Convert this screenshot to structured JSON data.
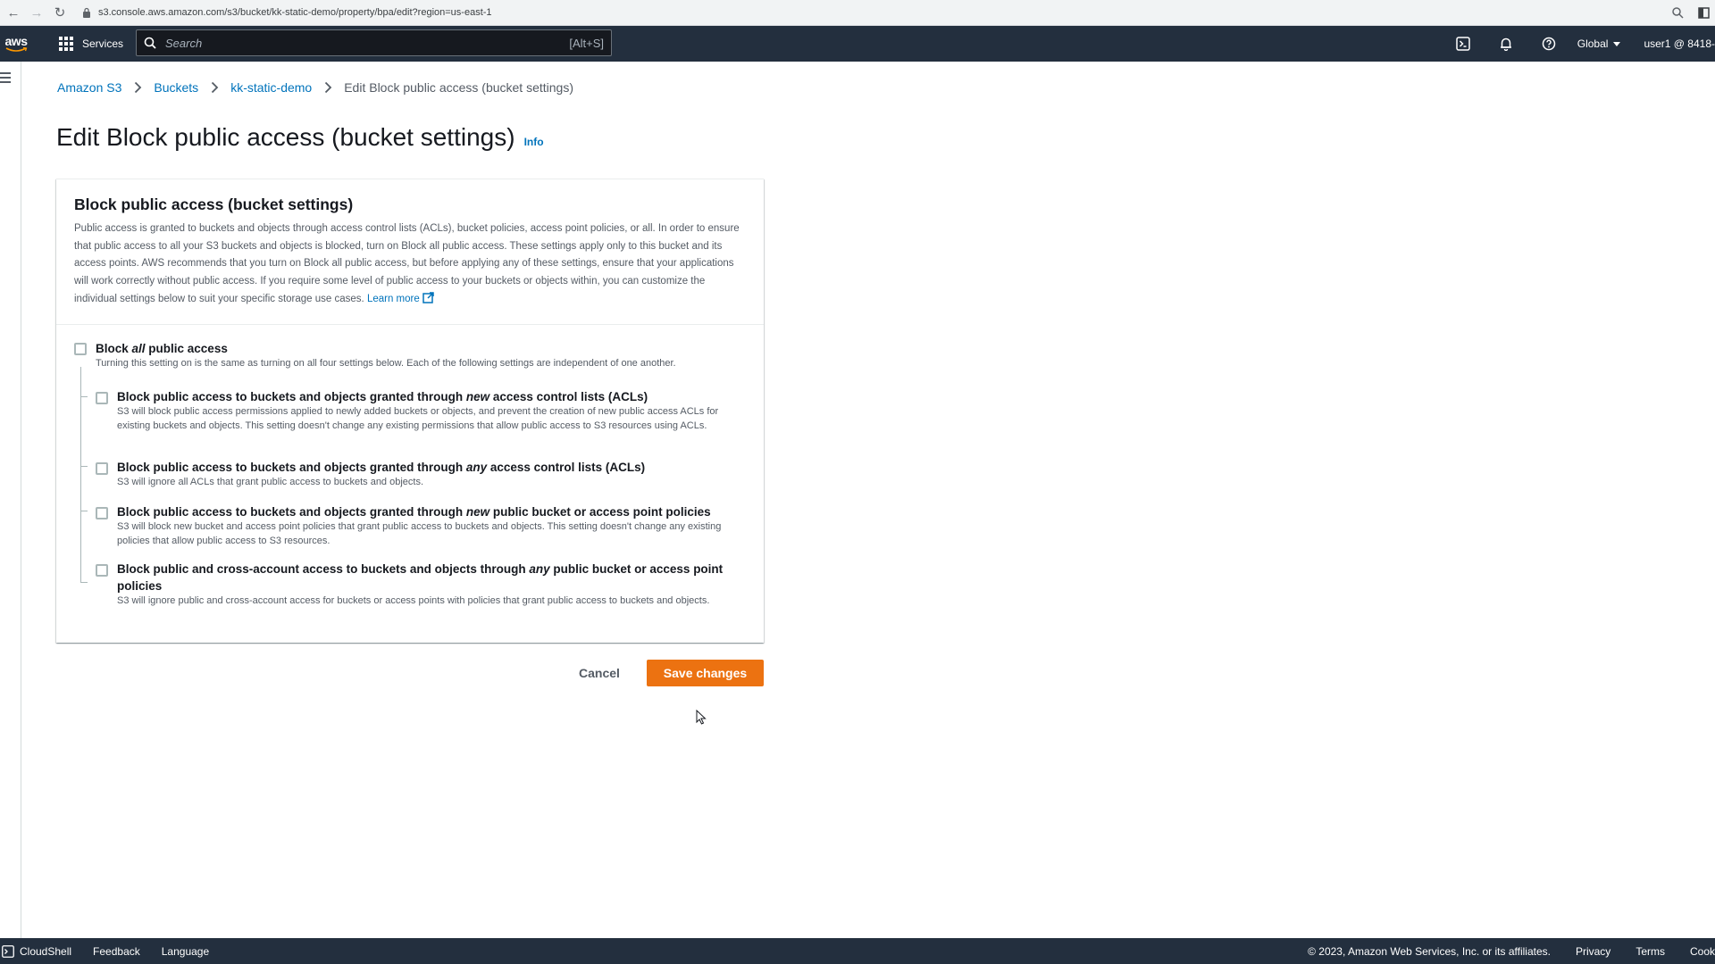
{
  "browser": {
    "url": "s3.console.aws.amazon.com/s3/bucket/kk-static-demo/property/bpa/edit?region=us-east-1"
  },
  "topnav": {
    "logo_text": "aws",
    "services_label": "Services",
    "search_placeholder": "Search",
    "search_shortcut": "[Alt+S]",
    "region_label": "Global",
    "user_label": "user1 @ 8418-"
  },
  "breadcrumb": {
    "items": [
      "Amazon S3",
      "Buckets",
      "kk-static-demo"
    ],
    "current": "Edit Block public access (bucket settings)"
  },
  "page": {
    "title": "Edit Block public access (bucket settings)",
    "info_label": "Info"
  },
  "panel": {
    "title": "Block public access (bucket settings)",
    "description": "Public access is granted to buckets and objects through access control lists (ACLs), bucket policies, access point policies, or all. In order to ensure that public access to all your S3 buckets and objects is blocked, turn on Block all public access. These settings apply only to this bucket and its access points. AWS recommends that you turn on Block all public access, but before applying any of these settings, ensure that your applications will work correctly without public access. If you require some level of public access to your buckets or objects within, you can customize the individual settings below to suit your specific storage use cases.",
    "learn_more": "Learn more"
  },
  "options": {
    "all": {
      "label_pre": "Block ",
      "label_em": "all",
      "label_post": " public access",
      "desc": "Turning this setting on is the same as turning on all four settings below. Each of the following settings are independent of one another.",
      "checked": false
    },
    "items": [
      {
        "label_pre": "Block public access to buckets and objects granted through ",
        "label_em": "new",
        "label_post": " access control lists (ACLs)",
        "desc": "S3 will block public access permissions applied to newly added buckets or objects, and prevent the creation of new public access ACLs for existing buckets and objects. This setting doesn't change any existing permissions that allow public access to S3 resources using ACLs.",
        "checked": false
      },
      {
        "label_pre": "Block public access to buckets and objects granted through ",
        "label_em": "any",
        "label_post": " access control lists (ACLs)",
        "desc": "S3 will ignore all ACLs that grant public access to buckets and objects.",
        "checked": false
      },
      {
        "label_pre": "Block public access to buckets and objects granted through ",
        "label_em": "new",
        "label_post": " public bucket or access point policies",
        "desc": "S3 will block new bucket and access point policies that grant public access to buckets and objects. This setting doesn't change any existing policies that allow public access to S3 resources.",
        "checked": false
      },
      {
        "label_pre": "Block public and cross-account access to buckets and objects through ",
        "label_em": "any",
        "label_post": " public bucket or access point policies",
        "desc": "S3 will ignore public and cross-account access for buckets or access points with policies that grant public access to buckets and objects.",
        "checked": false
      }
    ]
  },
  "actions": {
    "cancel": "Cancel",
    "save": "Save changes"
  },
  "footer": {
    "cloudshell": "CloudShell",
    "feedback": "Feedback",
    "language": "Language",
    "copyright": "© 2023, Amazon Web Services, Inc. or its affiliates.",
    "privacy": "Privacy",
    "terms": "Terms",
    "cookie": "Cook"
  },
  "colors": {
    "nav_bg": "#232f3e",
    "link": "#0073bb",
    "primary_button": "#ec7211"
  }
}
